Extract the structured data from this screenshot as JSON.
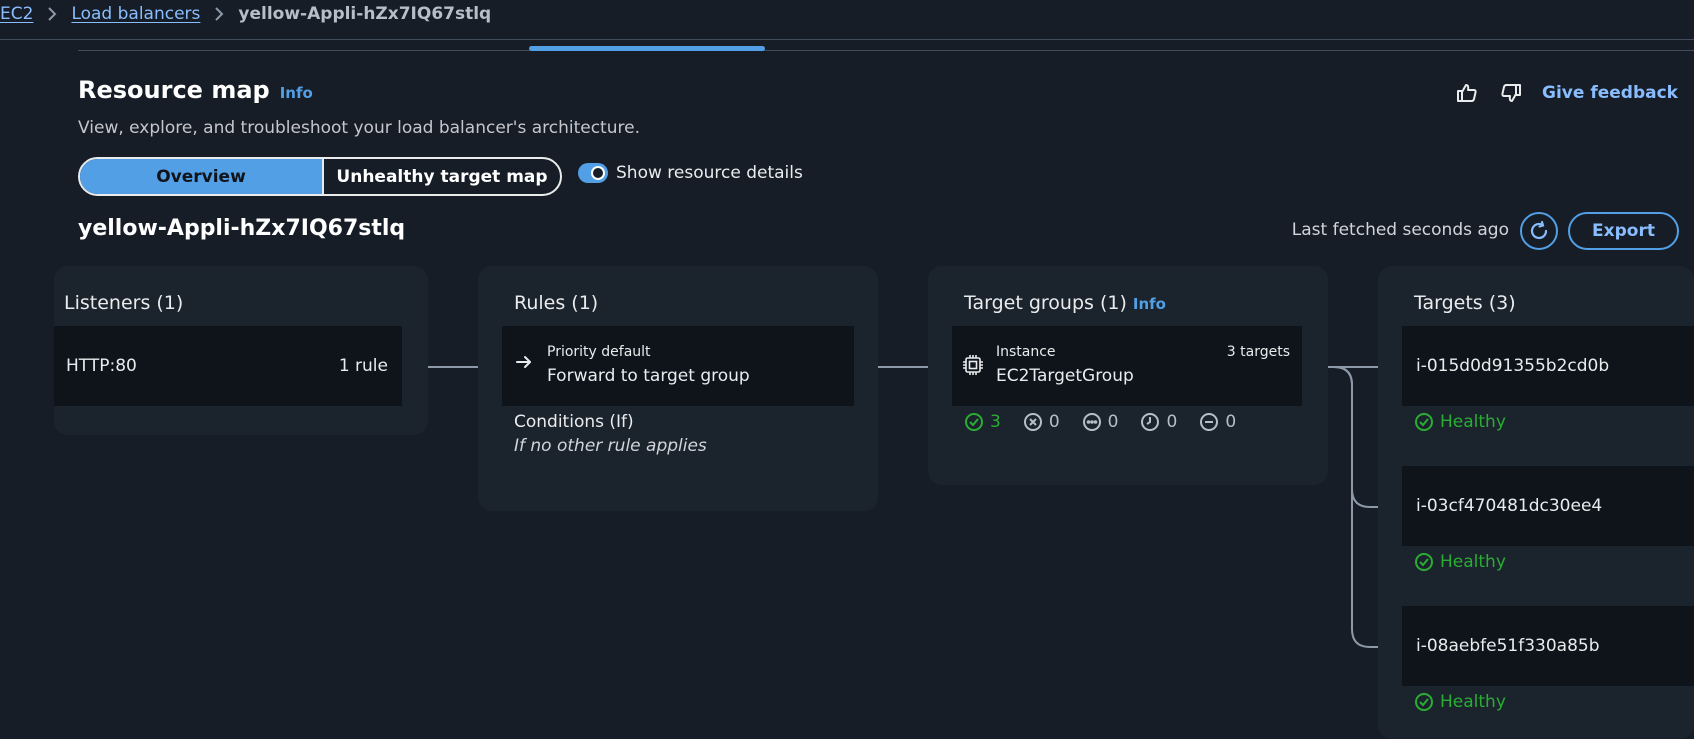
{
  "breadcrumb": {
    "items": [
      {
        "label": "EC2"
      },
      {
        "label": "Load balancers"
      }
    ],
    "current": "yellow-Appli-hZx7IQ67stlq"
  },
  "header": {
    "title": "Resource map",
    "info": "Info",
    "description": "View, explore, and troubleshoot your load balancer's architecture.",
    "feedback": "Give feedback"
  },
  "view_switch": {
    "overview": "Overview",
    "unhealthy": "Unhealthy target map"
  },
  "toggle": {
    "label": "Show resource details"
  },
  "lb_name": "yellow-Appli-hZx7IQ67stlq",
  "fetch": {
    "status": "Last fetched seconds ago",
    "export": "Export"
  },
  "listeners": {
    "title": "Listeners (1)",
    "item": {
      "name": "HTTP:80",
      "rules": "1 rule"
    }
  },
  "rules": {
    "title": "Rules (1)",
    "item": {
      "priority": "Priority default",
      "action": "Forward to target group"
    },
    "conditions_title": "Conditions (If)",
    "conditions_text": "If no other rule applies"
  },
  "target_groups": {
    "title": "Target groups (1)",
    "info": "Info",
    "item": {
      "type": "Instance",
      "name": "EC2TargetGroup",
      "count": "3 targets"
    },
    "counts": {
      "healthy": "3",
      "unhealthy": "0",
      "unused": "0",
      "pending": "0",
      "draining": "0"
    }
  },
  "targets": {
    "title": "Targets (3)",
    "items": [
      {
        "id": "i-015d0d91355b2cd0b",
        "status": "Healthy"
      },
      {
        "id": "i-03cf470481dc30ee4",
        "status": "Healthy"
      },
      {
        "id": "i-08aebfe51f330a85b",
        "status": "Healthy"
      }
    ]
  },
  "colors": {
    "accent": "#539fe5",
    "link": "#89bdff",
    "healthy": "#29ad32",
    "background": "#161d26",
    "panel": "#1b232d",
    "node": "#0f141a"
  }
}
